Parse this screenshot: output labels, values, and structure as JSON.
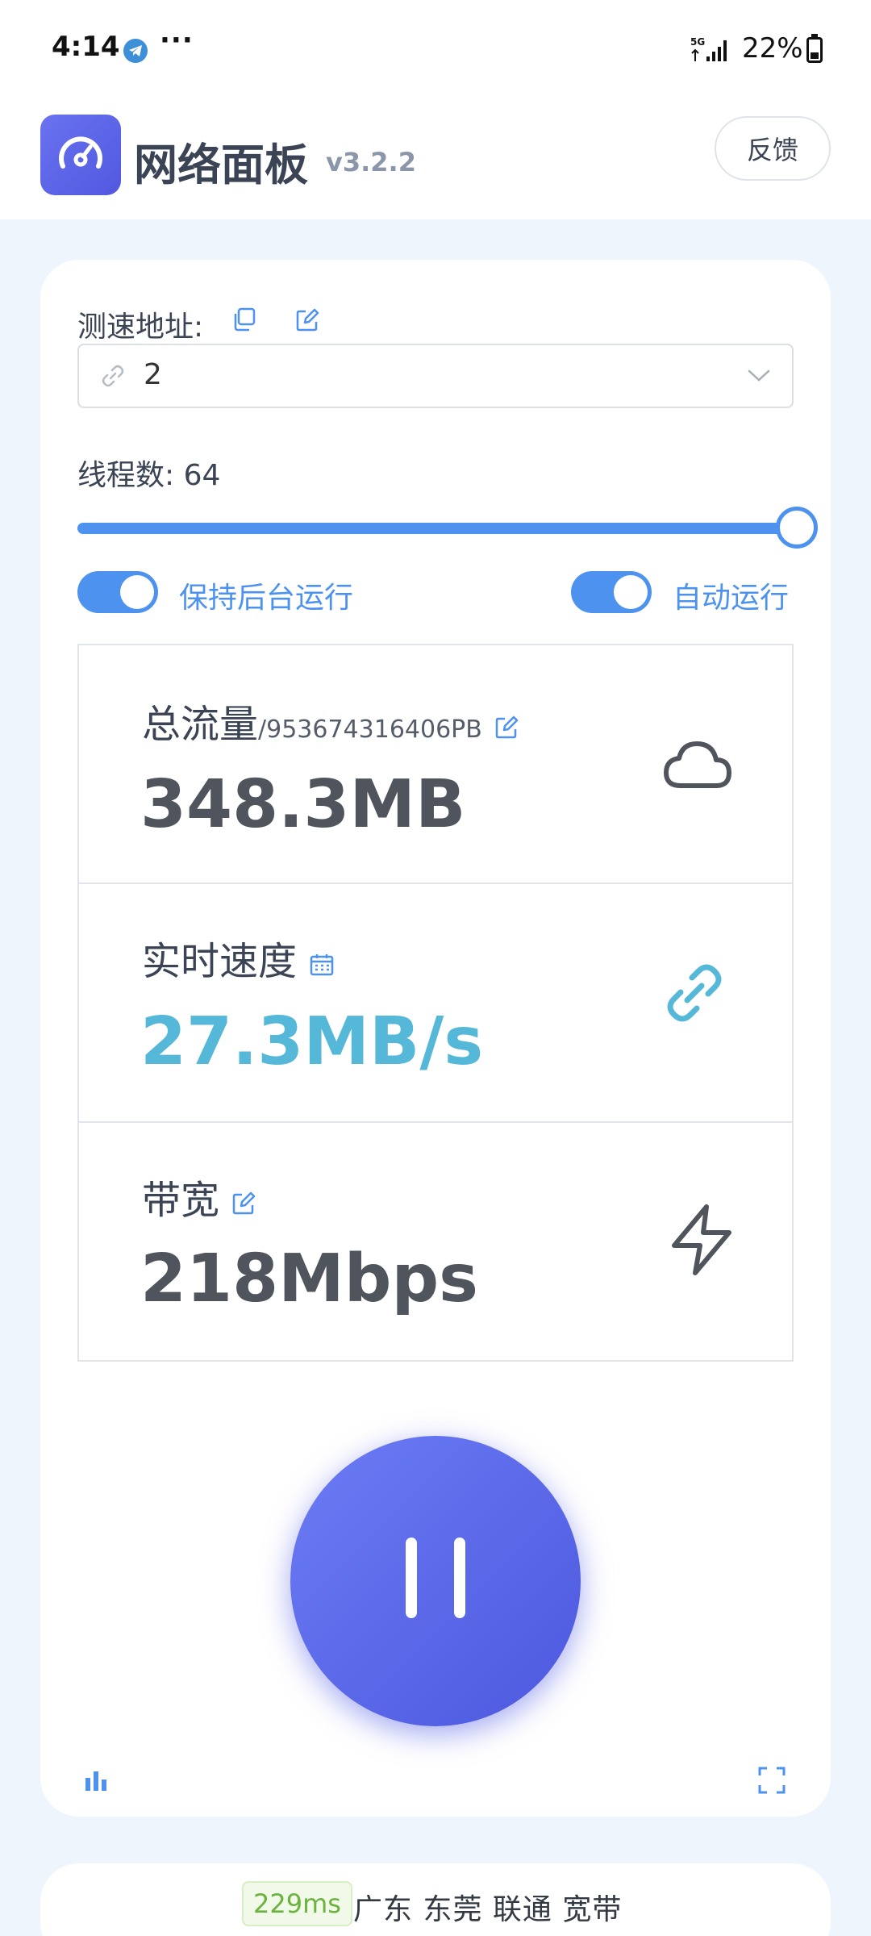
{
  "status_bar": {
    "time": "4:14",
    "more": "···",
    "battery": "22%"
  },
  "header": {
    "title": "网络面板",
    "version": "v3.2.2",
    "feedback_label": "反馈"
  },
  "settings": {
    "url_label": "测速地址:",
    "url_value": "2",
    "threads_label": "线程数: 64",
    "threads_value": 64,
    "threads_fraction": 1.0,
    "keep_background_label": "保持后台运行",
    "keep_background_on": true,
    "auto_run_label": "自动运行",
    "auto_run_on": true
  },
  "stats": {
    "total": {
      "title": "总流量",
      "limit": "/953674316406PB",
      "value": "348.3MB"
    },
    "speed": {
      "title": "实时速度",
      "value": "27.3MB/s"
    },
    "bandwidth": {
      "title": "带宽",
      "value": "218Mbps"
    }
  },
  "footer": {
    "latency": "229ms",
    "location": "广东 东莞 联通 宽带"
  },
  "colors": {
    "accent": "#4d92ef",
    "brand": "#5a62e8",
    "speed_value": "#56b8d8",
    "latency_green": "#6cb33d"
  }
}
